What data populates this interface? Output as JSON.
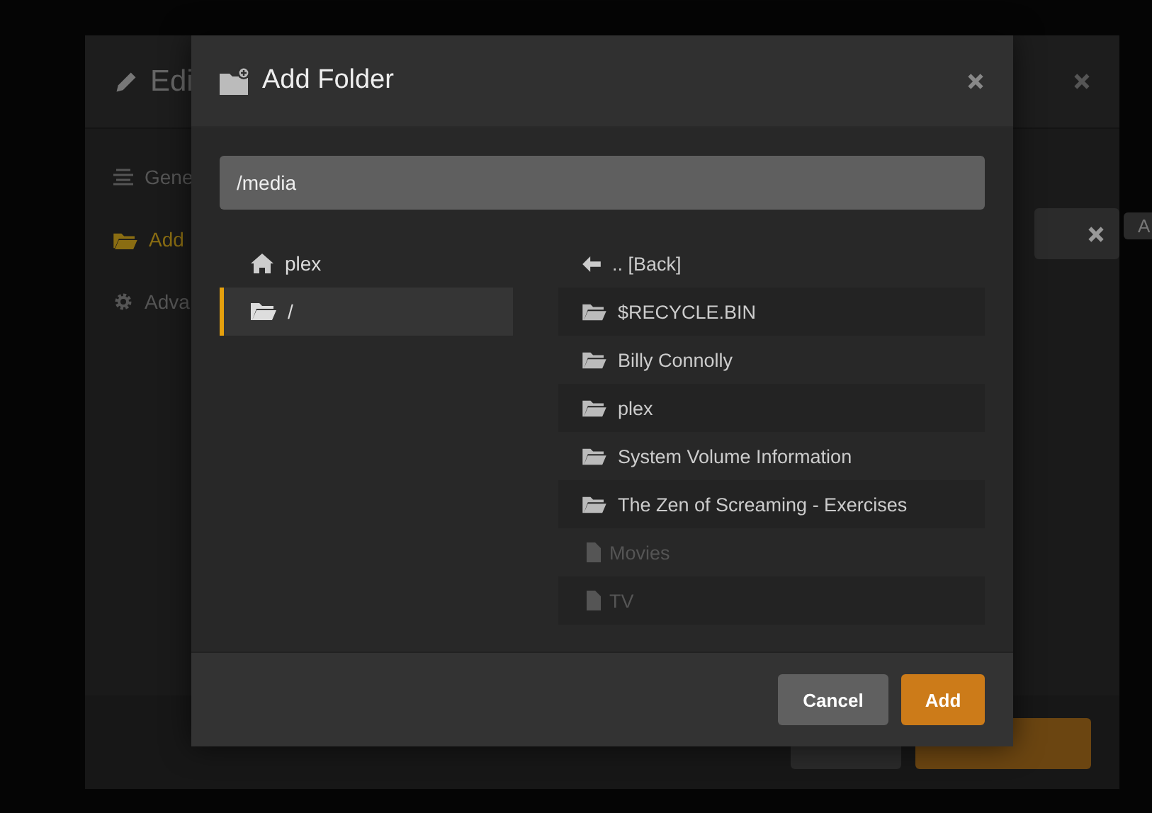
{
  "background_dialog": {
    "title": "Edi",
    "sidebar": [
      {
        "label": "Gene",
        "kind": "list",
        "selected": false
      },
      {
        "label": "Add",
        "kind": "folder",
        "selected": true
      },
      {
        "label": "Adva",
        "kind": "gear",
        "selected": false
      }
    ],
    "badge": "A",
    "buttons": [
      {
        "kind": "secondary"
      },
      {
        "kind": "primary"
      }
    ]
  },
  "dialog": {
    "title": "Add Folder",
    "path": "/media",
    "places": [
      {
        "label": "plex",
        "kind": "home",
        "selected": false
      },
      {
        "label": "/",
        "kind": "folder",
        "selected": true
      }
    ],
    "entries": [
      {
        "label": ".. [Back]",
        "kind": "back"
      },
      {
        "label": "$RECYCLE.BIN",
        "kind": "folder"
      },
      {
        "label": "Billy Connolly",
        "kind": "folder"
      },
      {
        "label": "plex",
        "kind": "folder"
      },
      {
        "label": "System Volume Information",
        "kind": "folder"
      },
      {
        "label": "The Zen of Screaming - Exercises",
        "kind": "folder"
      },
      {
        "label": "Movies",
        "kind": "file"
      },
      {
        "label": "TV",
        "kind": "file"
      }
    ],
    "buttons": [
      {
        "label": "Cancel",
        "kind": "secondary"
      },
      {
        "label": "Add",
        "kind": "primary"
      }
    ]
  }
}
